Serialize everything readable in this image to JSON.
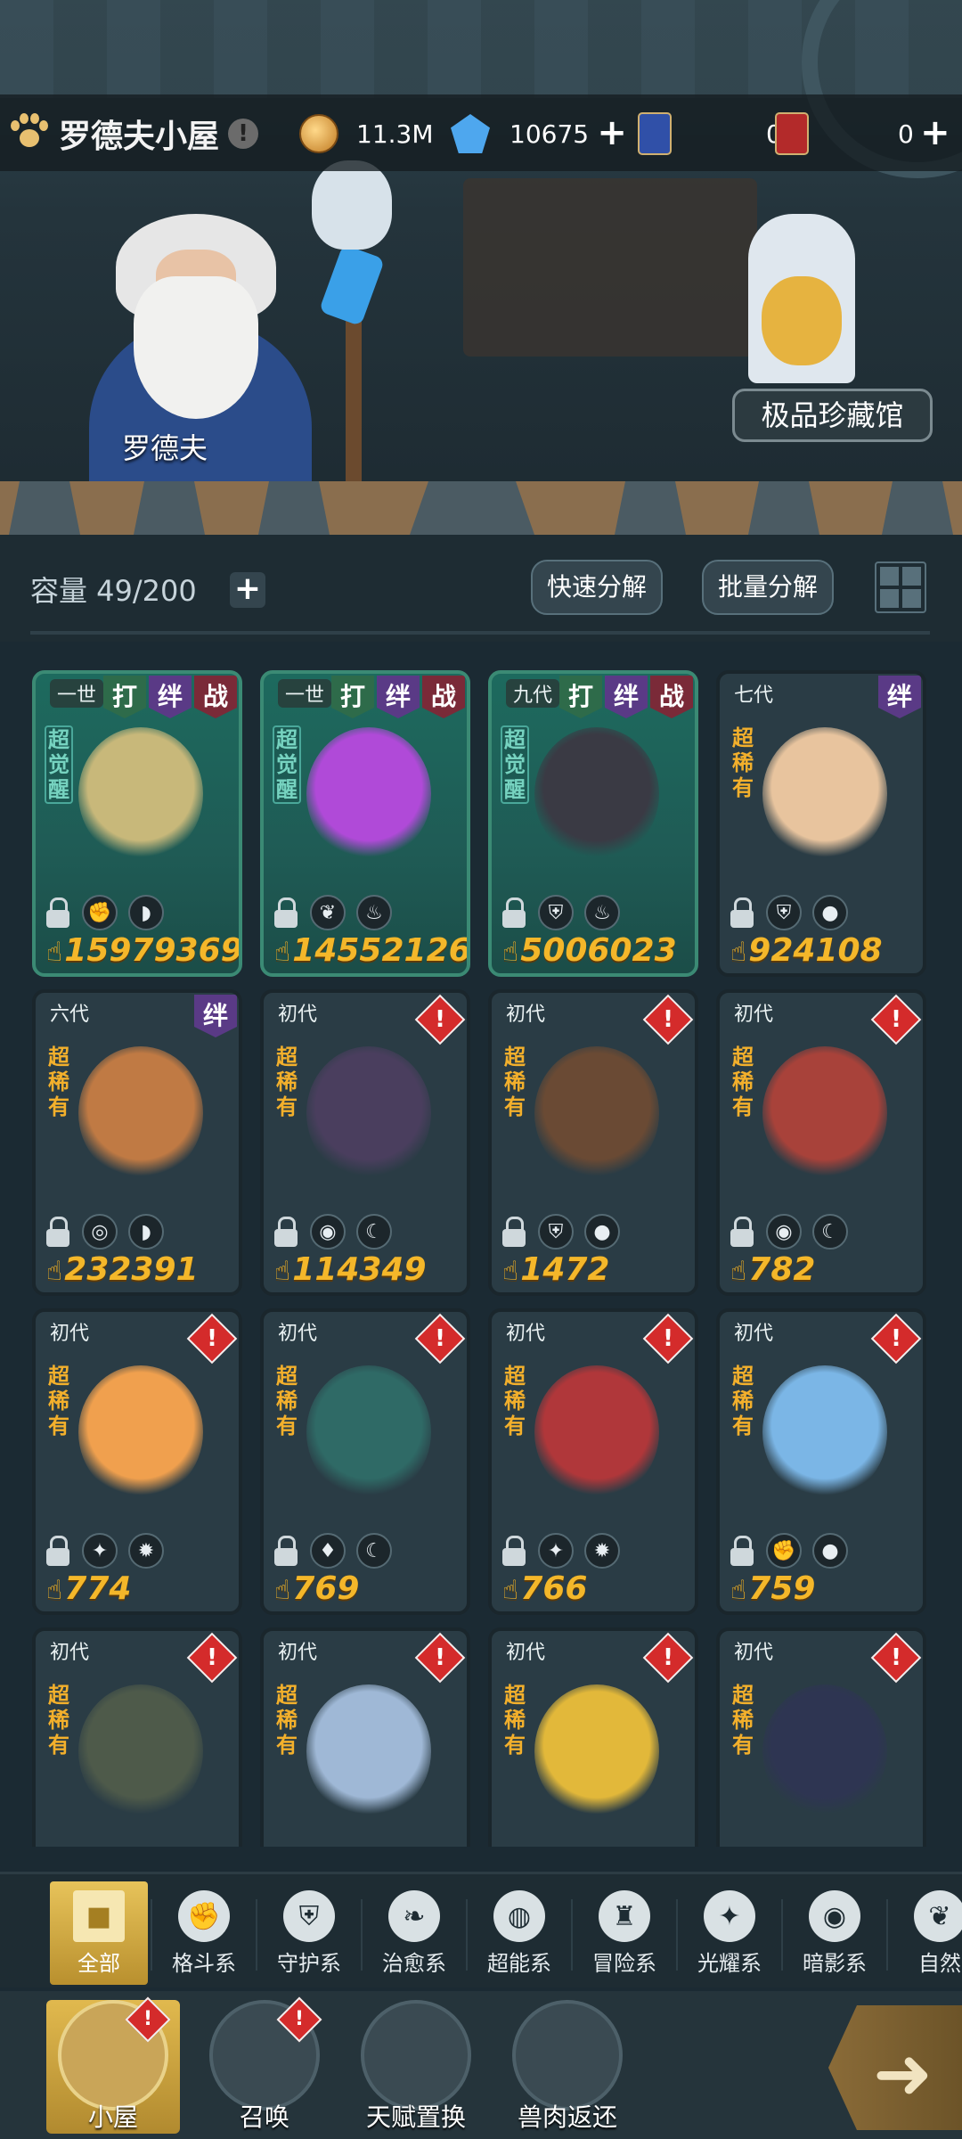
{
  "header": {
    "home_title": "罗德夫小屋",
    "warn_mark": "!",
    "coins": "11.3M",
    "gems": "10675",
    "card_a_count": "0",
    "card_b_count": "0",
    "plus": "+"
  },
  "scene": {
    "npc_name": "罗德夫",
    "museum_label": "极品珍藏馆"
  },
  "toolbar": {
    "capacity": "容量 49/200",
    "add": "+",
    "quick_decompose": "快速分解",
    "batch_decompose": "批量分解"
  },
  "cards": [
    {
      "gen": "一世",
      "tags": [
        "打",
        "绊",
        "战"
      ],
      "rarity": "超觉醒",
      "power": "15979369",
      "awaken": true,
      "alert": false,
      "color": "#c8b87a"
    },
    {
      "gen": "一世",
      "tags": [
        "打",
        "绊",
        "战"
      ],
      "rarity": "超觉醒",
      "power": "14552126",
      "awaken": true,
      "alert": false,
      "color": "#b04ad8"
    },
    {
      "gen": "九代",
      "tags": [
        "打",
        "绊",
        "战"
      ],
      "rarity": "超觉醒",
      "power": "5006023",
      "awaken": true,
      "alert": false,
      "color": "#3a3a44"
    },
    {
      "gen": "七代",
      "tags": [
        "绊"
      ],
      "rarity": "超稀有",
      "power": "924108",
      "awaken": false,
      "alert": false,
      "color": "#e8c49e"
    },
    {
      "gen": "六代",
      "tags": [
        "绊"
      ],
      "rarity": "超稀有",
      "power": "232391",
      "awaken": false,
      "alert": false,
      "color": "#c07a44"
    },
    {
      "gen": "初代",
      "tags": [],
      "rarity": "超稀有",
      "power": "114349",
      "awaken": false,
      "alert": true,
      "color": "#4a3e5e"
    },
    {
      "gen": "初代",
      "tags": [],
      "rarity": "超稀有",
      "power": "1472",
      "awaken": false,
      "alert": true,
      "color": "#6a4a34"
    },
    {
      "gen": "初代",
      "tags": [],
      "rarity": "超稀有",
      "power": "782",
      "awaken": false,
      "alert": true,
      "color": "#a8423a"
    },
    {
      "gen": "初代",
      "tags": [],
      "rarity": "超稀有",
      "power": "774",
      "awaken": false,
      "alert": true,
      "color": "#f0a04e"
    },
    {
      "gen": "初代",
      "tags": [],
      "rarity": "超稀有",
      "power": "769",
      "awaken": false,
      "alert": true,
      "color": "#2f6a66"
    },
    {
      "gen": "初代",
      "tags": [],
      "rarity": "超稀有",
      "power": "766",
      "awaken": false,
      "alert": true,
      "color": "#b0373a"
    },
    {
      "gen": "初代",
      "tags": [],
      "rarity": "超稀有",
      "power": "759",
      "awaken": false,
      "alert": true,
      "color": "#7bb6e6"
    },
    {
      "gen": "初代",
      "tags": [],
      "rarity": "超稀有",
      "power": "",
      "awaken": false,
      "alert": true,
      "color": "#4e5a4a"
    },
    {
      "gen": "初代",
      "tags": [],
      "rarity": "超稀有",
      "power": "",
      "awaken": false,
      "alert": true,
      "color": "#9fb8d6"
    },
    {
      "gen": "初代",
      "tags": [],
      "rarity": "超稀有",
      "power": "",
      "awaken": false,
      "alert": true,
      "color": "#e2b83a"
    },
    {
      "gen": "初代",
      "tags": [],
      "rarity": "超稀有",
      "power": "",
      "awaken": false,
      "alert": true,
      "color": "#2e3552"
    }
  ],
  "card_icons": [
    [
      "fist-icon",
      "meat-icon"
    ],
    [
      "leaf-icon",
      "fire-icon"
    ],
    [
      "shield-icon",
      "fire-icon"
    ],
    [
      "shield-icon",
      "drop-icon"
    ],
    [
      "target-icon",
      "meat-icon"
    ],
    [
      "eye-icon",
      "moon-icon"
    ],
    [
      "shield-icon",
      "drop-icon"
    ],
    [
      "eye-icon",
      "moon-icon"
    ],
    [
      "star-cross-icon",
      "sun-icon"
    ],
    [
      "flame-icon",
      "moon-icon"
    ],
    [
      "star-cross-icon",
      "sun-icon"
    ],
    [
      "fist-icon",
      "drop-icon"
    ]
  ],
  "tabs": [
    {
      "label": "全部",
      "icon": "blocks-icon"
    },
    {
      "label": "格斗系",
      "icon": "fist-icon"
    },
    {
      "label": "守护系",
      "icon": "shield-icon"
    },
    {
      "label": "治愈系",
      "icon": "sprout-icon"
    },
    {
      "label": "超能系",
      "icon": "mind-icon"
    },
    {
      "label": "冒险系",
      "icon": "lantern-icon"
    },
    {
      "label": "光耀系",
      "icon": "star-cross-icon"
    },
    {
      "label": "暗影系",
      "icon": "eye-icon"
    },
    {
      "label": "自然",
      "icon": "leaf-icon"
    }
  ],
  "nav": [
    {
      "label": "小屋",
      "badge": "!"
    },
    {
      "label": "召唤",
      "badge": "!"
    },
    {
      "label": "天赋置换",
      "badge": ""
    },
    {
      "label": "兽肉返还",
      "badge": ""
    }
  ]
}
